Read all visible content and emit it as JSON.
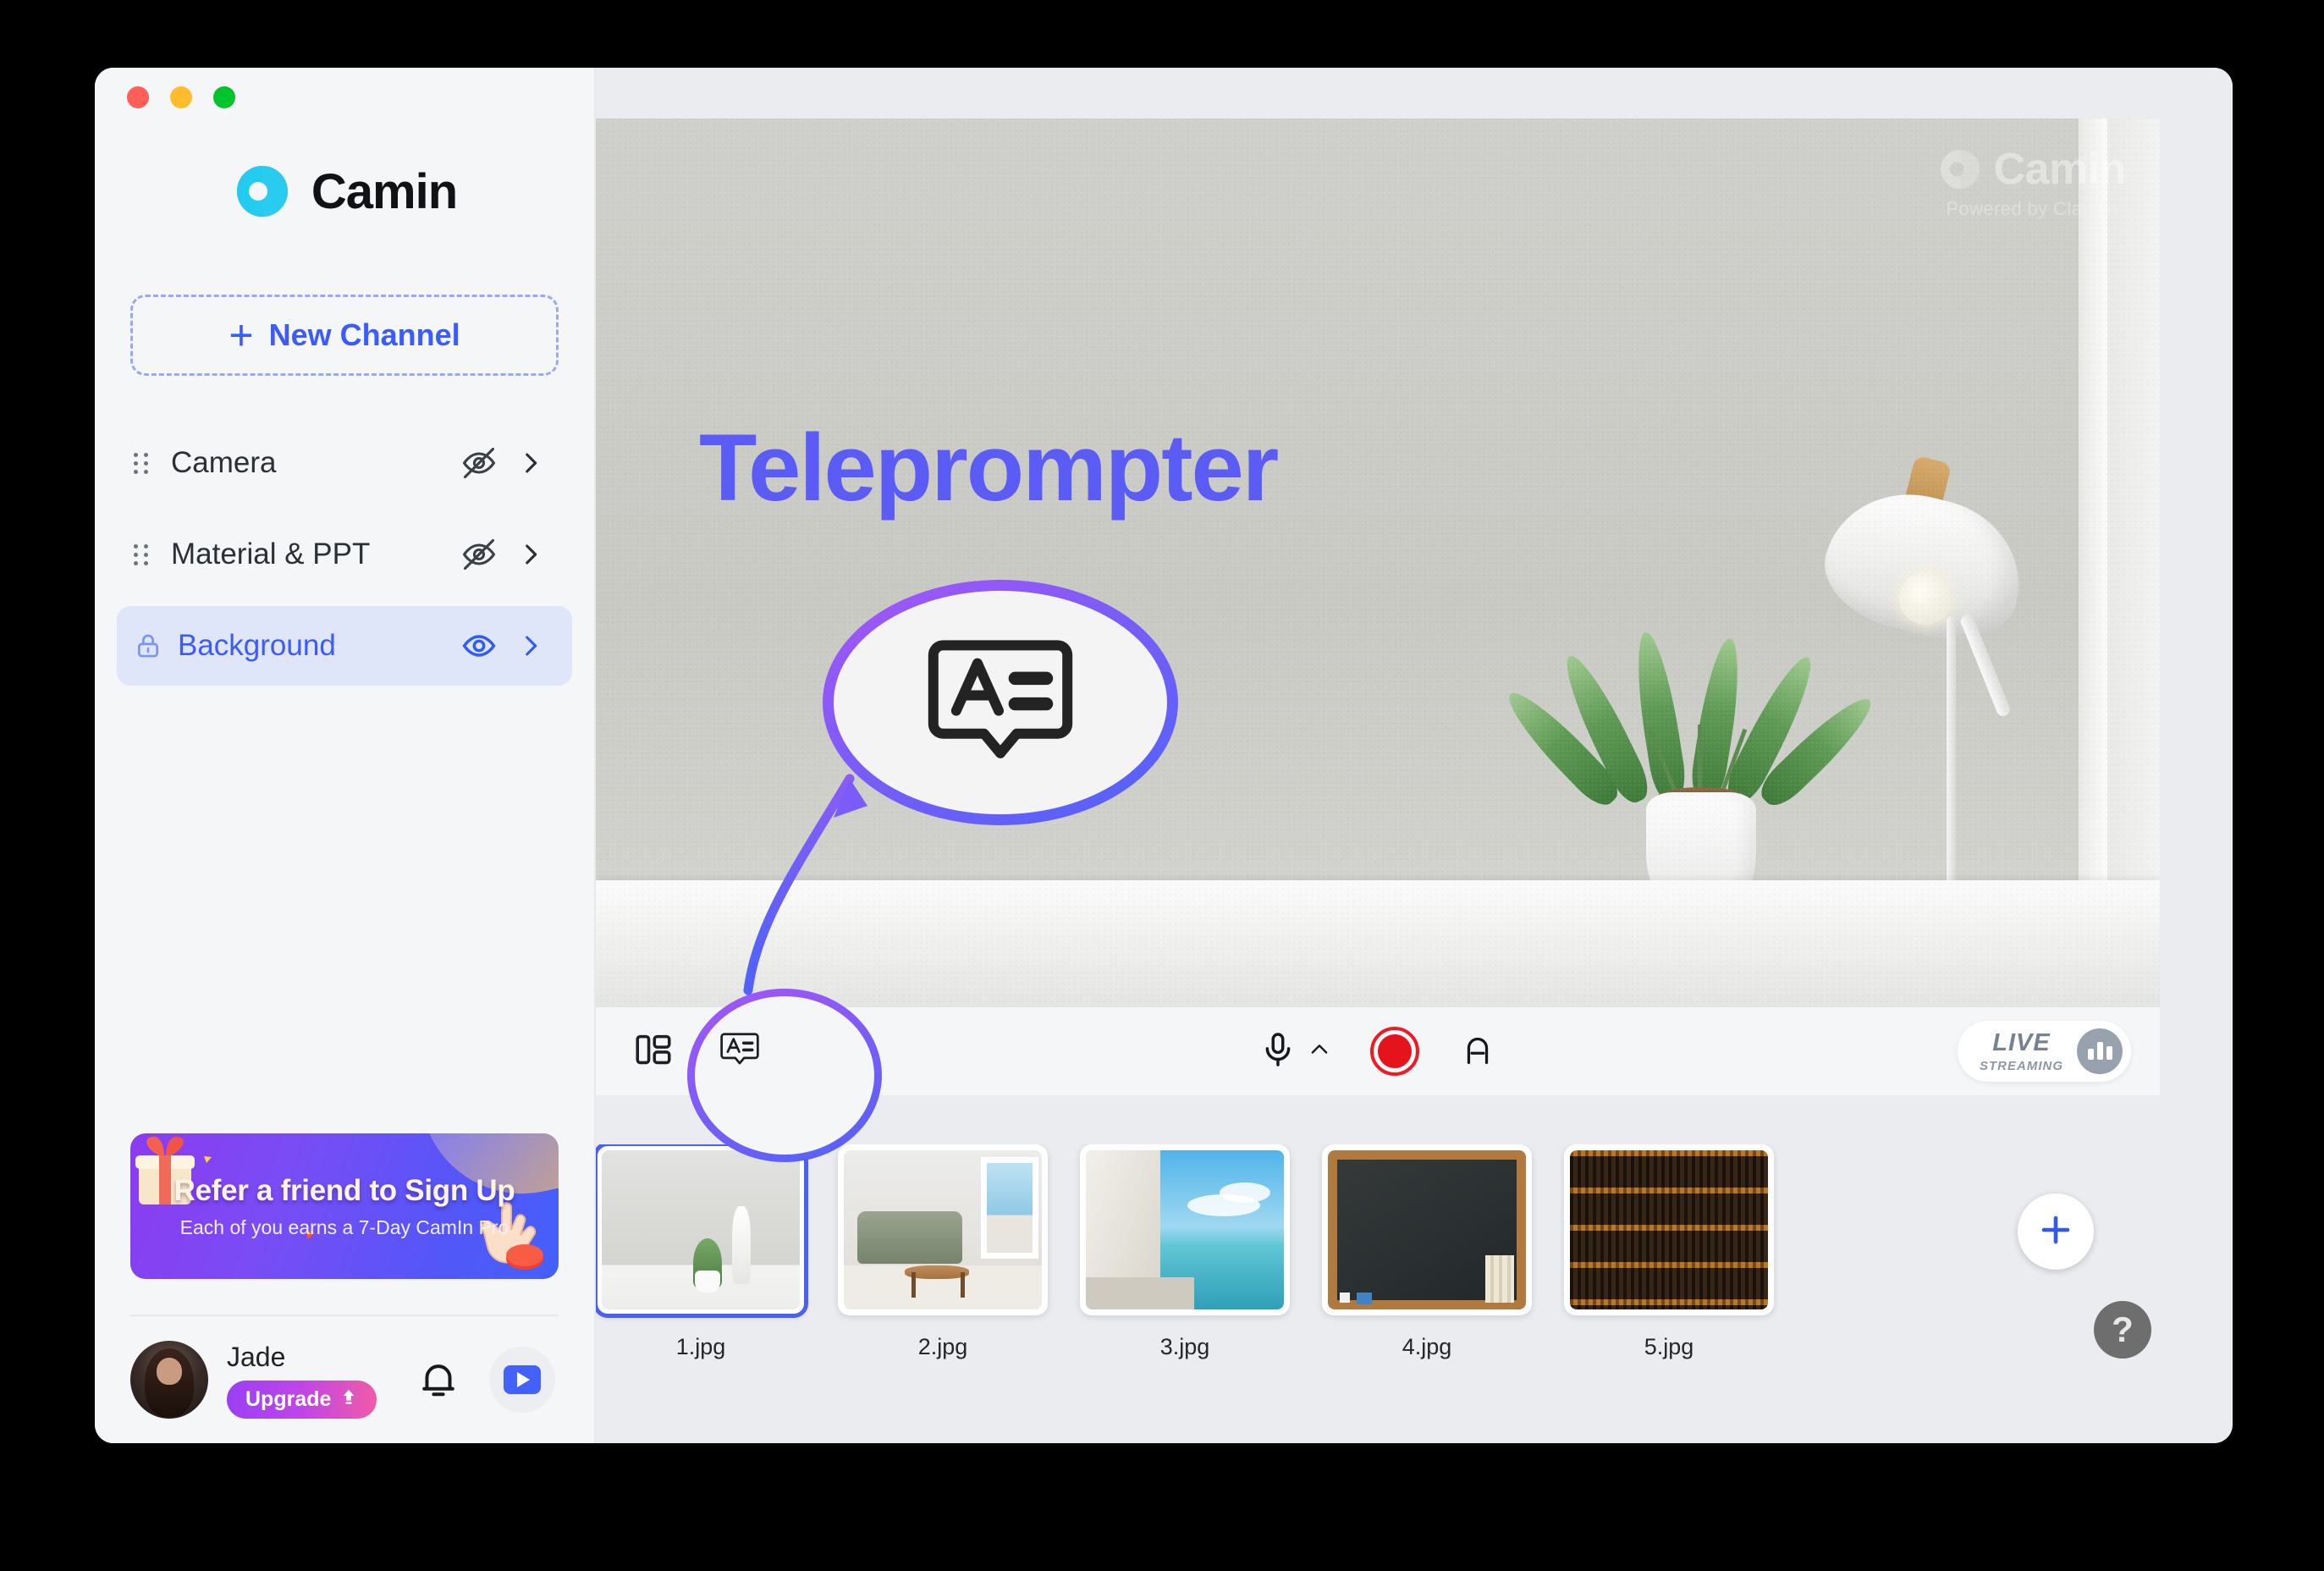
{
  "window": {
    "traffic_lights": [
      "close",
      "minimize",
      "maximize"
    ]
  },
  "sidebar": {
    "brand_name": "Camin",
    "new_channel": {
      "label": "New Channel",
      "icon": "plus-icon"
    },
    "nav_items": [
      {
        "label": "Camera",
        "icon": "grip-icon",
        "visibility": "hidden",
        "eye_icon": "eye-off-icon",
        "chevron": "chevron-right-icon",
        "active": false
      },
      {
        "label": "Material & PPT",
        "icon": "grip-icon",
        "visibility": "hidden",
        "eye_icon": "eye-off-icon",
        "chevron": "chevron-right-icon",
        "active": false
      },
      {
        "label": "Background",
        "icon": "lock-icon",
        "visibility": "visible",
        "eye_icon": "eye-icon",
        "chevron": "chevron-right-icon",
        "active": true
      }
    ],
    "promo": {
      "title": "Refer a friend to Sign Up",
      "subtitle": "Each of you earns a 7-Day CamIn Pro"
    },
    "user": {
      "name": "Jade",
      "upgrade_label": "Upgrade",
      "upgrade_icon": "upload-arrow-icon",
      "bell_icon": "bell-icon",
      "play_icon": "video-play-icon"
    }
  },
  "preview": {
    "watermark": {
      "name": "Camin",
      "sub": "Powered by ClassIn"
    },
    "annotation": {
      "title": "Teleprompter",
      "icon": "teleprompter-icon",
      "title_color": "#5b5bf5",
      "ring_color_start": "#a855f7",
      "ring_color_end": "#4f63fb"
    }
  },
  "toolbar": {
    "layout_icon": "layout-grid-icon",
    "teleprompter_icon": "teleprompter-icon",
    "mic_icon": "microphone-icon",
    "mic_chevron": "chevron-up-icon",
    "record_icon": "record-circle-icon",
    "text_icon": "text-a-icon",
    "live": {
      "line1": "LIVE",
      "line2": "STREAMING",
      "icon": "bar-chart-icon"
    }
  },
  "filmstrip": {
    "thumbnails": [
      {
        "name": "1.jpg",
        "selected": true
      },
      {
        "name": "2.jpg",
        "selected": false
      },
      {
        "name": "3.jpg",
        "selected": false
      },
      {
        "name": "4.jpg",
        "selected": false
      },
      {
        "name": "5.jpg",
        "selected": false
      }
    ],
    "add_button_icon": "plus-icon",
    "help_label": "?"
  }
}
